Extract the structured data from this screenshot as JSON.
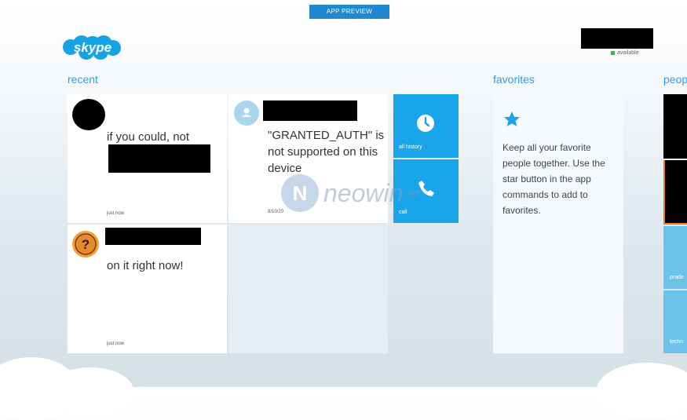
{
  "banner": {
    "label": "APP PREVIEW"
  },
  "app": {
    "name": "skype"
  },
  "user": {
    "status": "available"
  },
  "sections": {
    "recent": "recent",
    "favorites": "favorites",
    "people": "peop"
  },
  "recent": [
    {
      "text": "if you could, not",
      "time": "just now"
    },
    {
      "text": "\"GRANTED_AUTH\" is not supported on this device",
      "time": "8/10/20"
    },
    {
      "text": "on it right now!",
      "time": "just now"
    }
  ],
  "actions": {
    "history": "all history",
    "call": "call"
  },
  "favorites": {
    "text": "Keep all your favorite people together. Use the star button in the app commands to add to favorites."
  },
  "people": [
    {
      "label": "prade"
    },
    {
      "label": "techn"
    }
  ],
  "watermark": {
    "brand": "neowin",
    "suffix": ".net"
  },
  "colors": {
    "accent": "#1aa5eb",
    "banner": "#1e88d0",
    "title": "#2aa0e8"
  }
}
